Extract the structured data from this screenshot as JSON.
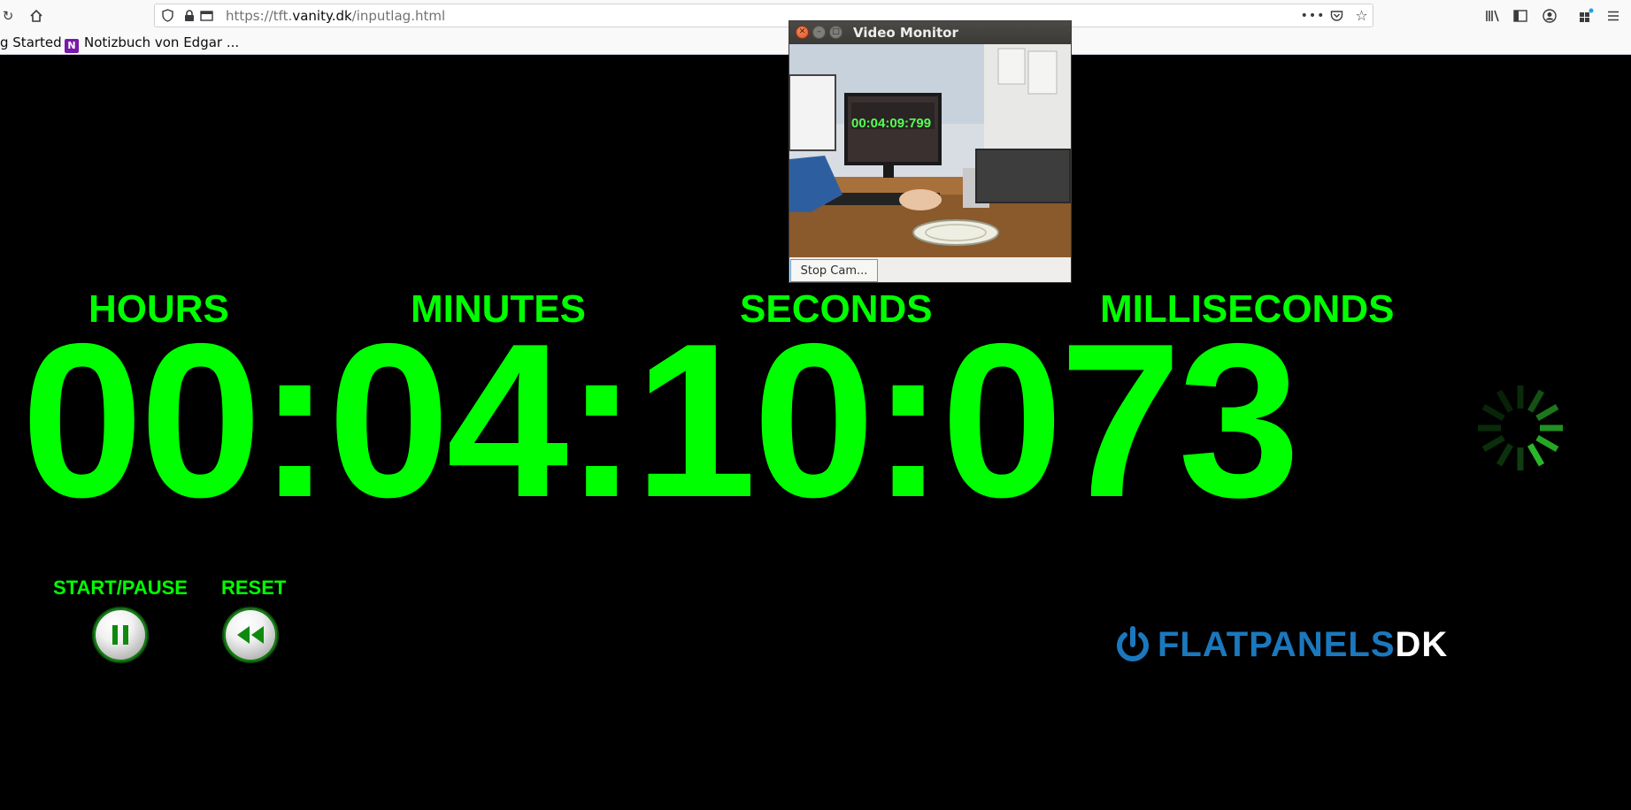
{
  "browser": {
    "url_scheme": "https://tft.",
    "url_host": "vanity.dk",
    "url_path": "/inputlag.html",
    "bookmarks": [
      "g Started",
      "Notizbuch von Edgar ..."
    ],
    "onenote_letter": "N"
  },
  "timer": {
    "labels": {
      "hours": "HOURS",
      "minutes": "MINUTES",
      "seconds": "SECONDS",
      "milliseconds": "MILLISECONDS"
    },
    "hours": "00",
    "minutes": "04",
    "seconds": "10",
    "milliseconds": "073",
    "separator": ":",
    "color": "#00ff00"
  },
  "controls": {
    "start_pause_label": "START/PAUSE",
    "reset_label": "RESET"
  },
  "logo": {
    "part1": "FLATPANELS",
    "part2": "DK",
    "color": "#1b78bd"
  },
  "video_monitor": {
    "title": "Video Monitor",
    "stop_button": "Stop Cam...",
    "camera_readout": "00:04:09:799"
  }
}
